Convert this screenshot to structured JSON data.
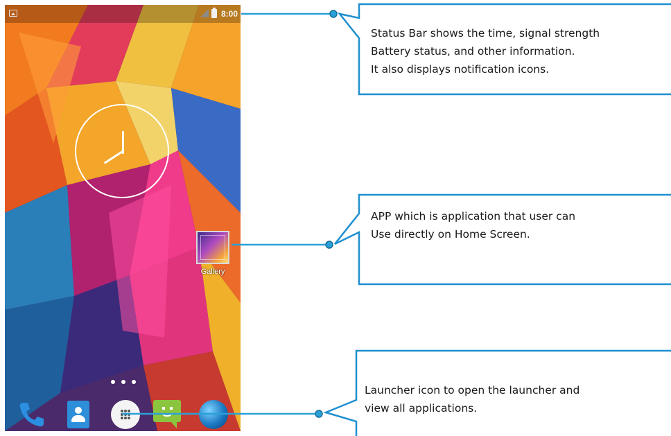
{
  "phone": {
    "status_bar": {
      "time": "8:00",
      "icons": [
        "image-notification-icon",
        "signal-icon",
        "battery-icon"
      ]
    },
    "widgets": {
      "clock": {
        "type": "analog-clock",
        "reading": "12:40"
      }
    },
    "apps": [
      {
        "label": "Gallery",
        "icon": "gallery-icon"
      }
    ],
    "page_indicator": {
      "count": 3,
      "current": 1
    },
    "dock": [
      {
        "icon": "phone-icon"
      },
      {
        "icon": "contacts-icon"
      },
      {
        "icon": "launcher-icon"
      },
      {
        "icon": "messaging-icon"
      },
      {
        "icon": "browser-globe-icon"
      }
    ]
  },
  "annotations": {
    "status_bar": {
      "lines": [
        "Status Bar shows the time, signal strength",
        "Battery status, and other information.",
        "It also displays notification icons."
      ]
    },
    "app": {
      "lines": [
        "APP which is application that user can",
        "Use directly on Home Screen."
      ]
    },
    "launcher": {
      "lines": [
        "Launcher icon to open the launcher and",
        "view all applications."
      ]
    }
  },
  "colors": {
    "callout_accent": "#2aa0d8",
    "callout_border": "#1e8fd0"
  }
}
